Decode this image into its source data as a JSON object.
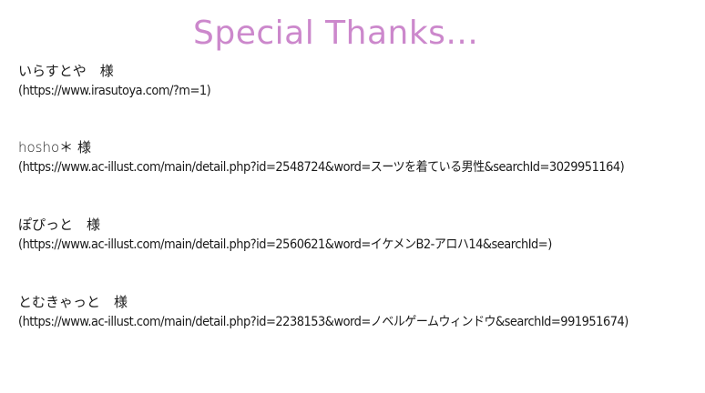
{
  "title": "Special Thanks...",
  "credits": [
    {
      "name": "いらすとや　様",
      "url": "(https://www.irasutoya.com/?m=1)"
    },
    {
      "name": "hosho＊ 様",
      "url": "(https://www.ac-illust.com/main/detail.php?id=2548724&word=スーツを着ている男性&searchId=3029951164)"
    },
    {
      "name": "ぽぴっと　様",
      "url": "(https://www.ac-illust.com/main/detail.php?id=2560621&word=イケメンB2-アロハ14&searchId=)"
    },
    {
      "name": "とむきゃっと　様",
      "url": "(https://www.ac-illust.com/main/detail.php?id=2238153&word=ノベルゲームウィンドウ&searchId=991951674)"
    }
  ],
  "colors": {
    "title": "#cc88cc",
    "text": "#1a1a1a",
    "background": "#ffffff"
  }
}
